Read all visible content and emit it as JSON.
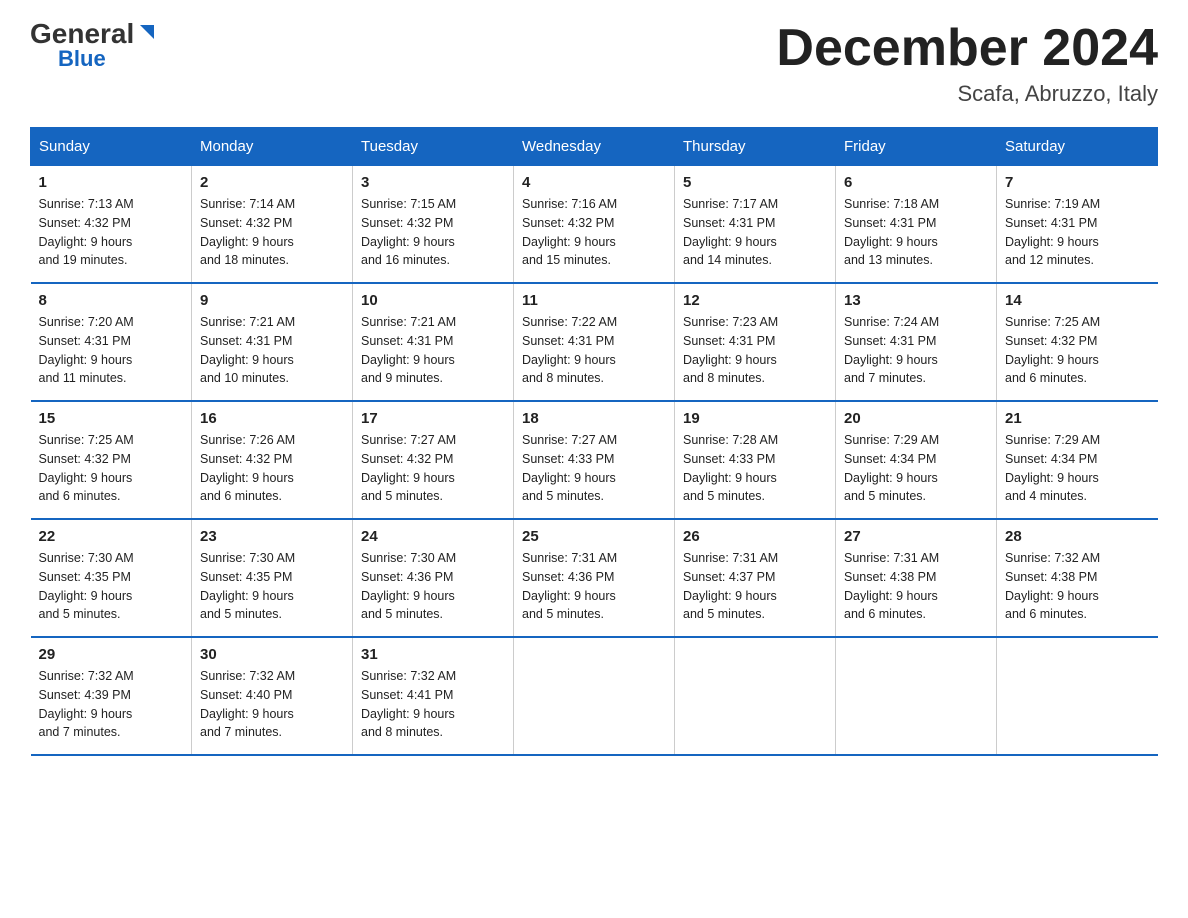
{
  "logo": {
    "general": "General",
    "arrow": "▶",
    "blue": "Blue"
  },
  "title": "December 2024",
  "location": "Scafa, Abruzzo, Italy",
  "days_of_week": [
    "Sunday",
    "Monday",
    "Tuesday",
    "Wednesday",
    "Thursday",
    "Friday",
    "Saturday"
  ],
  "weeks": [
    [
      {
        "day": "1",
        "sunrise": "7:13 AM",
        "sunset": "4:32 PM",
        "daylight": "9 hours and 19 minutes."
      },
      {
        "day": "2",
        "sunrise": "7:14 AM",
        "sunset": "4:32 PM",
        "daylight": "9 hours and 18 minutes."
      },
      {
        "day": "3",
        "sunrise": "7:15 AM",
        "sunset": "4:32 PM",
        "daylight": "9 hours and 16 minutes."
      },
      {
        "day": "4",
        "sunrise": "7:16 AM",
        "sunset": "4:32 PM",
        "daylight": "9 hours and 15 minutes."
      },
      {
        "day": "5",
        "sunrise": "7:17 AM",
        "sunset": "4:31 PM",
        "daylight": "9 hours and 14 minutes."
      },
      {
        "day": "6",
        "sunrise": "7:18 AM",
        "sunset": "4:31 PM",
        "daylight": "9 hours and 13 minutes."
      },
      {
        "day": "7",
        "sunrise": "7:19 AM",
        "sunset": "4:31 PM",
        "daylight": "9 hours and 12 minutes."
      }
    ],
    [
      {
        "day": "8",
        "sunrise": "7:20 AM",
        "sunset": "4:31 PM",
        "daylight": "9 hours and 11 minutes."
      },
      {
        "day": "9",
        "sunrise": "7:21 AM",
        "sunset": "4:31 PM",
        "daylight": "9 hours and 10 minutes."
      },
      {
        "day": "10",
        "sunrise": "7:21 AM",
        "sunset": "4:31 PM",
        "daylight": "9 hours and 9 minutes."
      },
      {
        "day": "11",
        "sunrise": "7:22 AM",
        "sunset": "4:31 PM",
        "daylight": "9 hours and 8 minutes."
      },
      {
        "day": "12",
        "sunrise": "7:23 AM",
        "sunset": "4:31 PM",
        "daylight": "9 hours and 8 minutes."
      },
      {
        "day": "13",
        "sunrise": "7:24 AM",
        "sunset": "4:31 PM",
        "daylight": "9 hours and 7 minutes."
      },
      {
        "day": "14",
        "sunrise": "7:25 AM",
        "sunset": "4:32 PM",
        "daylight": "9 hours and 6 minutes."
      }
    ],
    [
      {
        "day": "15",
        "sunrise": "7:25 AM",
        "sunset": "4:32 PM",
        "daylight": "9 hours and 6 minutes."
      },
      {
        "day": "16",
        "sunrise": "7:26 AM",
        "sunset": "4:32 PM",
        "daylight": "9 hours and 6 minutes."
      },
      {
        "day": "17",
        "sunrise": "7:27 AM",
        "sunset": "4:32 PM",
        "daylight": "9 hours and 5 minutes."
      },
      {
        "day": "18",
        "sunrise": "7:27 AM",
        "sunset": "4:33 PM",
        "daylight": "9 hours and 5 minutes."
      },
      {
        "day": "19",
        "sunrise": "7:28 AM",
        "sunset": "4:33 PM",
        "daylight": "9 hours and 5 minutes."
      },
      {
        "day": "20",
        "sunrise": "7:29 AM",
        "sunset": "4:34 PM",
        "daylight": "9 hours and 5 minutes."
      },
      {
        "day": "21",
        "sunrise": "7:29 AM",
        "sunset": "4:34 PM",
        "daylight": "9 hours and 4 minutes."
      }
    ],
    [
      {
        "day": "22",
        "sunrise": "7:30 AM",
        "sunset": "4:35 PM",
        "daylight": "9 hours and 5 minutes."
      },
      {
        "day": "23",
        "sunrise": "7:30 AM",
        "sunset": "4:35 PM",
        "daylight": "9 hours and 5 minutes."
      },
      {
        "day": "24",
        "sunrise": "7:30 AM",
        "sunset": "4:36 PM",
        "daylight": "9 hours and 5 minutes."
      },
      {
        "day": "25",
        "sunrise": "7:31 AM",
        "sunset": "4:36 PM",
        "daylight": "9 hours and 5 minutes."
      },
      {
        "day": "26",
        "sunrise": "7:31 AM",
        "sunset": "4:37 PM",
        "daylight": "9 hours and 5 minutes."
      },
      {
        "day": "27",
        "sunrise": "7:31 AM",
        "sunset": "4:38 PM",
        "daylight": "9 hours and 6 minutes."
      },
      {
        "day": "28",
        "sunrise": "7:32 AM",
        "sunset": "4:38 PM",
        "daylight": "9 hours and 6 minutes."
      }
    ],
    [
      {
        "day": "29",
        "sunrise": "7:32 AM",
        "sunset": "4:39 PM",
        "daylight": "9 hours and 7 minutes."
      },
      {
        "day": "30",
        "sunrise": "7:32 AM",
        "sunset": "4:40 PM",
        "daylight": "9 hours and 7 minutes."
      },
      {
        "day": "31",
        "sunrise": "7:32 AM",
        "sunset": "4:41 PM",
        "daylight": "9 hours and 8 minutes."
      },
      null,
      null,
      null,
      null
    ]
  ],
  "labels": {
    "sunrise": "Sunrise:",
    "sunset": "Sunset:",
    "daylight": "Daylight:"
  }
}
